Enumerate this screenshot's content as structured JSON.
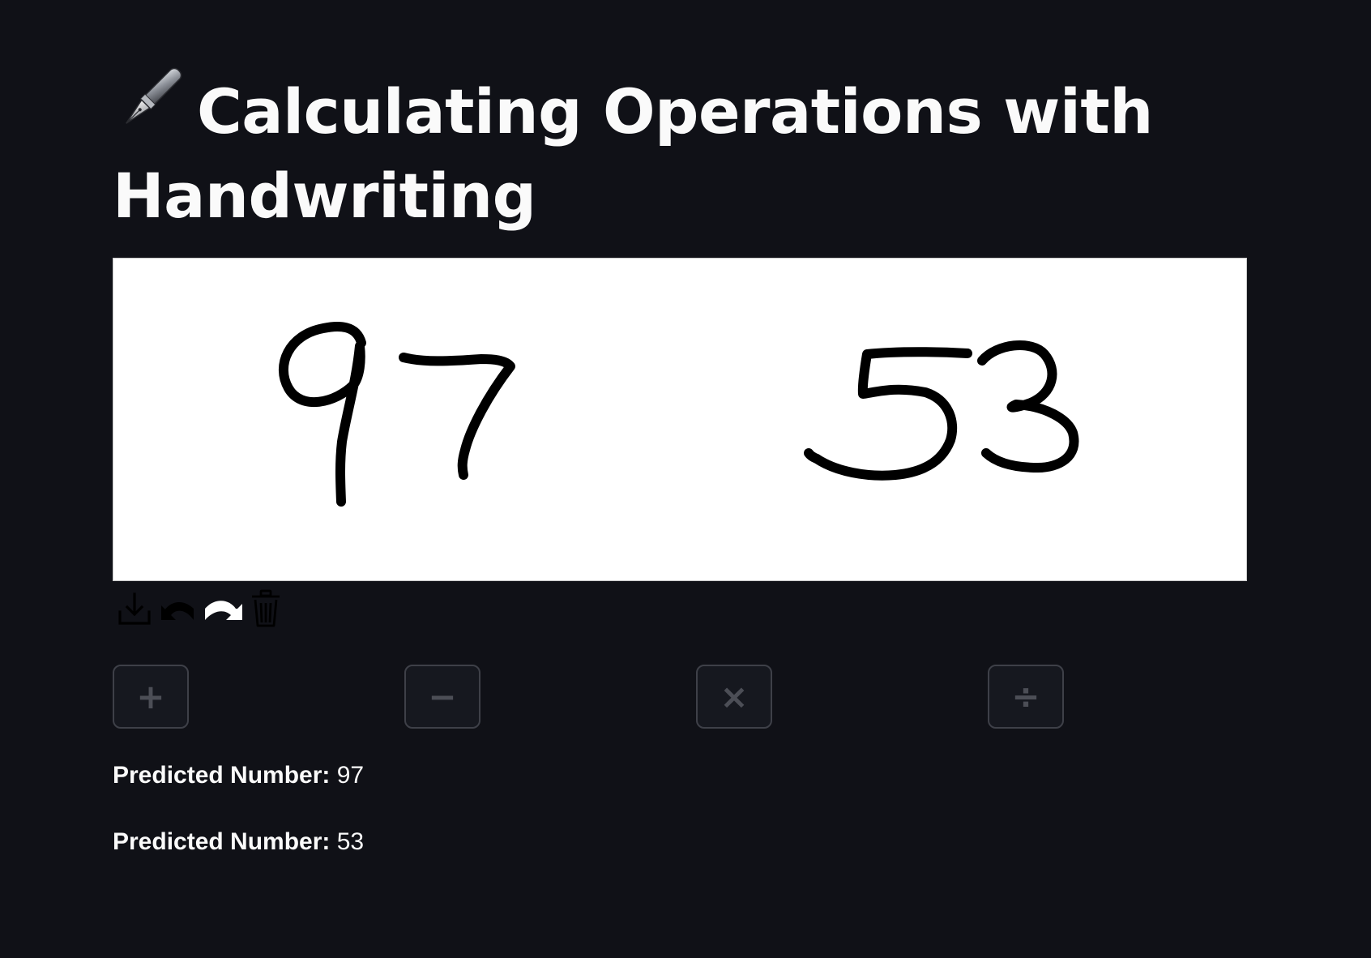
{
  "header": {
    "title": "Calculating Operations with Handwriting",
    "emoji_icon": "fountain-pen-icon"
  },
  "canvas": {
    "background": "#ffffff",
    "stroke_color": "#000000",
    "drawn_numbers": [
      "97",
      "53"
    ]
  },
  "toolbar": {
    "icons": [
      "download-icon",
      "undo-icon",
      "redo-icon",
      "trash-icon"
    ]
  },
  "operations": [
    {
      "symbol": "+",
      "icon": "plus-icon"
    },
    {
      "symbol": "−",
      "icon": "minus-icon"
    },
    {
      "symbol": "×",
      "icon": "multiply-icon"
    },
    {
      "symbol": "÷",
      "icon": "divide-icon"
    }
  ],
  "predictions": [
    {
      "label": "Predicted Number:",
      "value": "97"
    },
    {
      "label": "Predicted Number:",
      "value": "53"
    }
  ],
  "colors": {
    "background": "#101117",
    "text": "#fafafa",
    "button_border": "#3e4048",
    "button_symbol": "#4c4e56"
  }
}
